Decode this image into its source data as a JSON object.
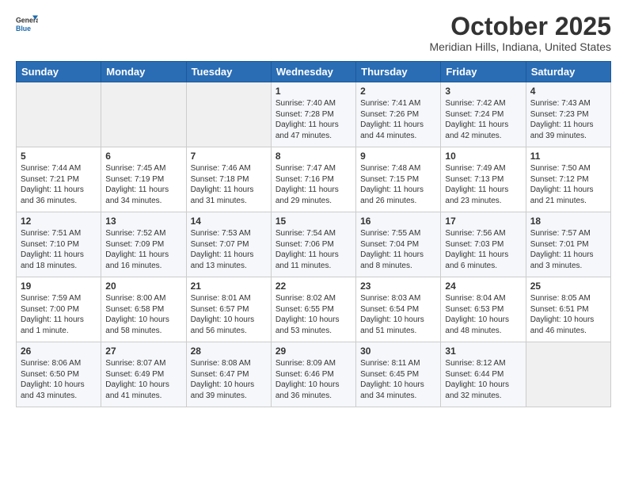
{
  "logo": {
    "general": "General",
    "blue": "Blue"
  },
  "title": "October 2025",
  "location": "Meridian Hills, Indiana, United States",
  "days_of_week": [
    "Sunday",
    "Monday",
    "Tuesday",
    "Wednesday",
    "Thursday",
    "Friday",
    "Saturday"
  ],
  "weeks": [
    [
      {
        "day": "",
        "info": ""
      },
      {
        "day": "",
        "info": ""
      },
      {
        "day": "",
        "info": ""
      },
      {
        "day": "1",
        "info": "Sunrise: 7:40 AM\nSunset: 7:28 PM\nDaylight: 11 hours and 47 minutes."
      },
      {
        "day": "2",
        "info": "Sunrise: 7:41 AM\nSunset: 7:26 PM\nDaylight: 11 hours and 44 minutes."
      },
      {
        "day": "3",
        "info": "Sunrise: 7:42 AM\nSunset: 7:24 PM\nDaylight: 11 hours and 42 minutes."
      },
      {
        "day": "4",
        "info": "Sunrise: 7:43 AM\nSunset: 7:23 PM\nDaylight: 11 hours and 39 minutes."
      }
    ],
    [
      {
        "day": "5",
        "info": "Sunrise: 7:44 AM\nSunset: 7:21 PM\nDaylight: 11 hours and 36 minutes."
      },
      {
        "day": "6",
        "info": "Sunrise: 7:45 AM\nSunset: 7:19 PM\nDaylight: 11 hours and 34 minutes."
      },
      {
        "day": "7",
        "info": "Sunrise: 7:46 AM\nSunset: 7:18 PM\nDaylight: 11 hours and 31 minutes."
      },
      {
        "day": "8",
        "info": "Sunrise: 7:47 AM\nSunset: 7:16 PM\nDaylight: 11 hours and 29 minutes."
      },
      {
        "day": "9",
        "info": "Sunrise: 7:48 AM\nSunset: 7:15 PM\nDaylight: 11 hours and 26 minutes."
      },
      {
        "day": "10",
        "info": "Sunrise: 7:49 AM\nSunset: 7:13 PM\nDaylight: 11 hours and 23 minutes."
      },
      {
        "day": "11",
        "info": "Sunrise: 7:50 AM\nSunset: 7:12 PM\nDaylight: 11 hours and 21 minutes."
      }
    ],
    [
      {
        "day": "12",
        "info": "Sunrise: 7:51 AM\nSunset: 7:10 PM\nDaylight: 11 hours and 18 minutes."
      },
      {
        "day": "13",
        "info": "Sunrise: 7:52 AM\nSunset: 7:09 PM\nDaylight: 11 hours and 16 minutes."
      },
      {
        "day": "14",
        "info": "Sunrise: 7:53 AM\nSunset: 7:07 PM\nDaylight: 11 hours and 13 minutes."
      },
      {
        "day": "15",
        "info": "Sunrise: 7:54 AM\nSunset: 7:06 PM\nDaylight: 11 hours and 11 minutes."
      },
      {
        "day": "16",
        "info": "Sunrise: 7:55 AM\nSunset: 7:04 PM\nDaylight: 11 hours and 8 minutes."
      },
      {
        "day": "17",
        "info": "Sunrise: 7:56 AM\nSunset: 7:03 PM\nDaylight: 11 hours and 6 minutes."
      },
      {
        "day": "18",
        "info": "Sunrise: 7:57 AM\nSunset: 7:01 PM\nDaylight: 11 hours and 3 minutes."
      }
    ],
    [
      {
        "day": "19",
        "info": "Sunrise: 7:59 AM\nSunset: 7:00 PM\nDaylight: 11 hours and 1 minute."
      },
      {
        "day": "20",
        "info": "Sunrise: 8:00 AM\nSunset: 6:58 PM\nDaylight: 10 hours and 58 minutes."
      },
      {
        "day": "21",
        "info": "Sunrise: 8:01 AM\nSunset: 6:57 PM\nDaylight: 10 hours and 56 minutes."
      },
      {
        "day": "22",
        "info": "Sunrise: 8:02 AM\nSunset: 6:55 PM\nDaylight: 10 hours and 53 minutes."
      },
      {
        "day": "23",
        "info": "Sunrise: 8:03 AM\nSunset: 6:54 PM\nDaylight: 10 hours and 51 minutes."
      },
      {
        "day": "24",
        "info": "Sunrise: 8:04 AM\nSunset: 6:53 PM\nDaylight: 10 hours and 48 minutes."
      },
      {
        "day": "25",
        "info": "Sunrise: 8:05 AM\nSunset: 6:51 PM\nDaylight: 10 hours and 46 minutes."
      }
    ],
    [
      {
        "day": "26",
        "info": "Sunrise: 8:06 AM\nSunset: 6:50 PM\nDaylight: 10 hours and 43 minutes."
      },
      {
        "day": "27",
        "info": "Sunrise: 8:07 AM\nSunset: 6:49 PM\nDaylight: 10 hours and 41 minutes."
      },
      {
        "day": "28",
        "info": "Sunrise: 8:08 AM\nSunset: 6:47 PM\nDaylight: 10 hours and 39 minutes."
      },
      {
        "day": "29",
        "info": "Sunrise: 8:09 AM\nSunset: 6:46 PM\nDaylight: 10 hours and 36 minutes."
      },
      {
        "day": "30",
        "info": "Sunrise: 8:11 AM\nSunset: 6:45 PM\nDaylight: 10 hours and 34 minutes."
      },
      {
        "day": "31",
        "info": "Sunrise: 8:12 AM\nSunset: 6:44 PM\nDaylight: 10 hours and 32 minutes."
      },
      {
        "day": "",
        "info": ""
      }
    ]
  ]
}
